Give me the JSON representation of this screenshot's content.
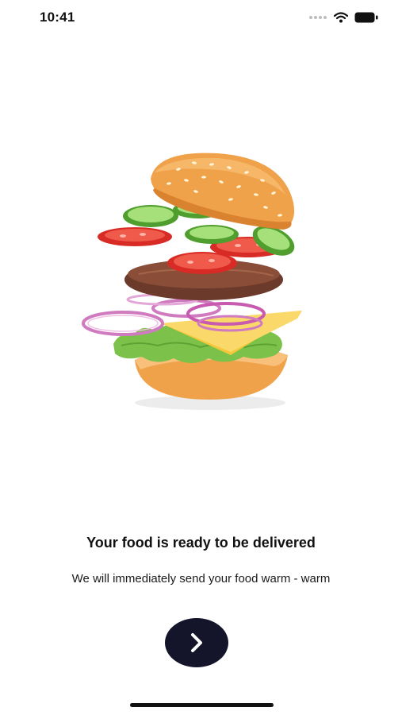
{
  "status_bar": {
    "time": "10:41",
    "icons": [
      "signal-dots-icon",
      "wifi-icon",
      "battery-icon"
    ]
  },
  "illustration": {
    "name": "exploded-burger-icon"
  },
  "content": {
    "headline": "Your food is ready to be delivered",
    "subtitle": "We will immediately send your food warm - warm"
  },
  "actions": {
    "next_icon": "chevron-right-icon",
    "next_button_color": "#14142b"
  },
  "colors": {
    "background": "#ffffff",
    "text": "#111111",
    "bun": "#f0a24a",
    "tomato": "#d92b26",
    "lettuce": "#7cc24a",
    "cheese": "#f6c73a",
    "patty": "#6b3a2a",
    "onion": "#d07ac0"
  }
}
